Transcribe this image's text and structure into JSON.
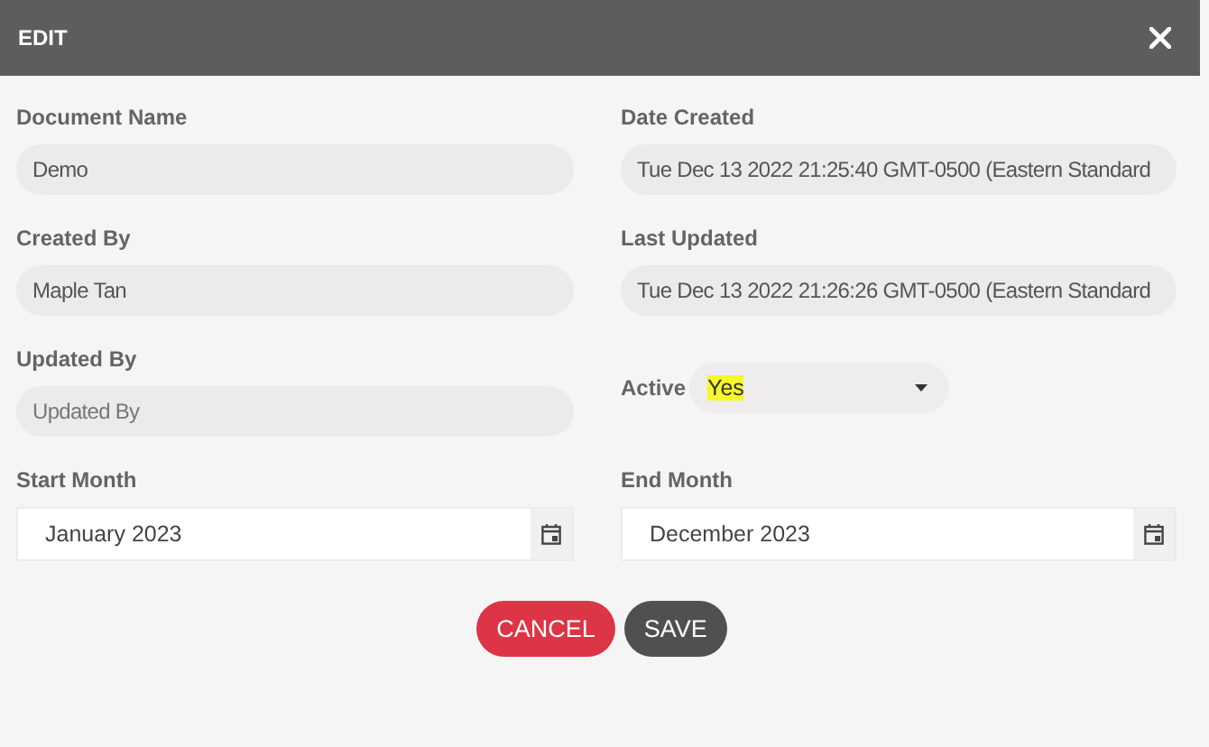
{
  "window": {
    "title": "EDIT"
  },
  "fields": [
    {
      "kind": "text",
      "label": "Document Name",
      "value": "Demo"
    },
    {
      "kind": "text",
      "label": "Date Created",
      "value": "Tue Dec 13 2022 21:25:40 GMT-0500 (Eastern Standard"
    },
    {
      "kind": "text",
      "label": "Created By",
      "value": "Maple Tan"
    },
    {
      "kind": "text",
      "label": "Last Updated",
      "value": "Tue Dec 13 2022 21:26:26 GMT-0500 (Eastern Standard"
    },
    {
      "kind": "text",
      "label": "Updated By",
      "placeholder": "Updated By"
    },
    {
      "kind": "select",
      "label": "Active",
      "value": "Yes",
      "highlighted": true
    },
    {
      "kind": "month",
      "label": "Start Month",
      "value": "January 2023"
    },
    {
      "kind": "month",
      "label": "End Month",
      "value": "December 2023"
    }
  ],
  "buttons": [
    {
      "label": "CANCEL",
      "kind": "danger"
    },
    {
      "label": "SAVE",
      "kind": "dark"
    }
  ]
}
